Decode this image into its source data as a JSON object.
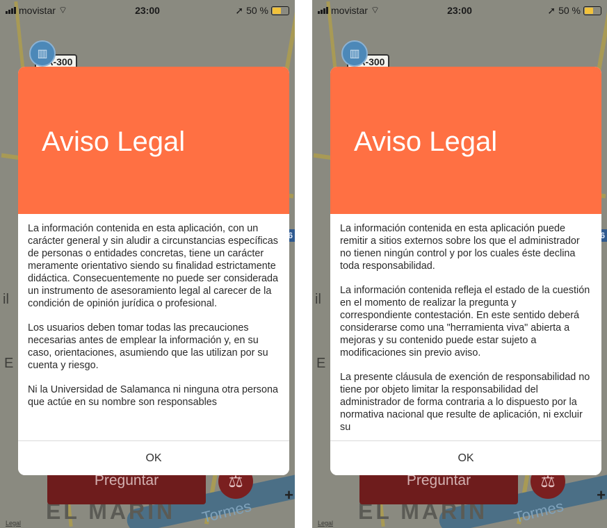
{
  "status": {
    "carrier": "movistar",
    "time": "23:00",
    "battery": "50 %",
    "battery_level": 0.5
  },
  "map": {
    "road_badge": "SA-300",
    "route_badge": "66",
    "area_label": "EL MARIN",
    "river_label": "Tormes",
    "legal_link": "Legal",
    "zoom_in": "+",
    "side_letter_il": "il",
    "side_letter_e": "E"
  },
  "bottom": {
    "ask_label": "Preguntar"
  },
  "modal": {
    "title": "Aviso Legal",
    "ok_label": "OK"
  },
  "screens": [
    {
      "paragraphs": [
        "La información contenida en esta aplicación, con un carácter general y sin aludir a circunstancias específicas de personas o entidades concretas, tiene un carácter meramente orientativo siendo su finalidad estrictamente didáctica. Consecuentemente  no puede ser considerada un instrumento de asesoramiento legal al carecer de la condición de opinión jurídica o profesional.",
        "Los usuarios deben tomar todas las precauciones necesarias antes de emplear la información y, en su caso, orientaciones,  asumiendo que las utilizan por su cuenta y riesgo.",
        "Ni la Universidad de Salamanca ni ninguna otra persona que actúe en su nombre son responsables"
      ]
    },
    {
      "paragraphs": [
        "La información contenida en esta aplicación puede remitir a sitios externos sobre los que el administrador no tienen ningún control y por los cuales éste declina toda responsabilidad.",
        "La información contenida refleja el estado de la cuestión en el momento de realizar la pregunta y correspondiente contestación. En este sentido deberá considerarse como una \"herramienta viva\" abierta a mejoras y su contenido puede estar sujeto a modificaciones sin previo aviso.",
        "La presente cláusula de exención de responsabilidad no tiene por objeto limitar la responsabilidad del administrador de forma contraria a lo dispuesto por la normativa nacional que resulte de aplicación, ni excluir su"
      ]
    }
  ]
}
